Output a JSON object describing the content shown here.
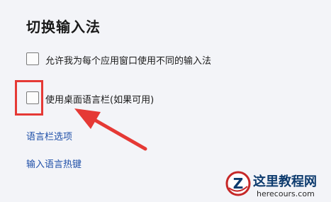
{
  "section": {
    "title": "切换输入法"
  },
  "options": [
    {
      "label": "允许我为每个应用窗口使用不同的输入法",
      "checked": false
    },
    {
      "label": "使用桌面语言栏(如果可用)",
      "checked": false,
      "highlighted": true
    }
  ],
  "links": {
    "language_bar_options": "语言栏选项",
    "input_language_hotkeys": "输入语言热键"
  },
  "annotation": {
    "color": "#e53935"
  },
  "watermark": {
    "logo_letter": "Z",
    "title": "这里教程网",
    "url": "herecours.com"
  }
}
